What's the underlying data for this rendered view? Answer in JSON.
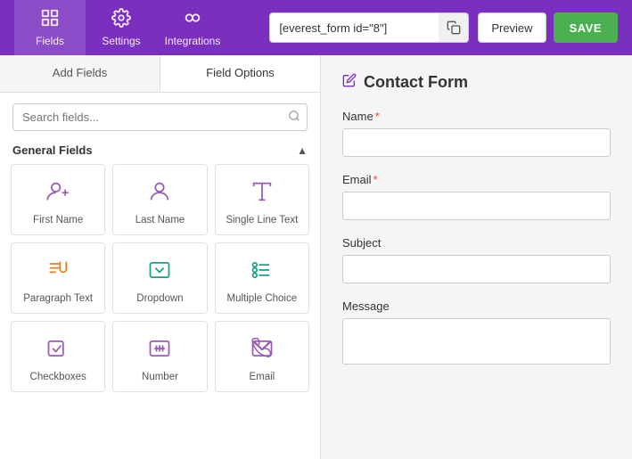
{
  "nav": {
    "items": [
      {
        "id": "fields",
        "label": "Fields",
        "active": true
      },
      {
        "id": "settings",
        "label": "Settings",
        "active": false
      },
      {
        "id": "integrations",
        "label": "Integrations",
        "active": false
      }
    ]
  },
  "toolbar": {
    "shortcode_value": "[everest_form id=\"8\"]",
    "preview_label": "Preview",
    "save_label": "SAVE"
  },
  "left_panel": {
    "tab_add": "Add Fields",
    "tab_options": "Field Options",
    "search_placeholder": "Search fields...",
    "section_label": "General Fields",
    "fields": [
      {
        "id": "first-name",
        "label": "First Name",
        "icon": "person",
        "color": "purple"
      },
      {
        "id": "last-name",
        "label": "Last Name",
        "icon": "person",
        "color": "purple"
      },
      {
        "id": "single-line",
        "label": "Single Line Text",
        "icon": "text",
        "color": "purple"
      },
      {
        "id": "paragraph",
        "label": "Paragraph Text",
        "icon": "paragraph",
        "color": "orange"
      },
      {
        "id": "dropdown",
        "label": "Dropdown",
        "icon": "dropdown",
        "color": "teal"
      },
      {
        "id": "multiple-choice",
        "label": "Multiple Choice",
        "icon": "radio",
        "color": "teal"
      },
      {
        "id": "checkboxes",
        "label": "Checkboxes",
        "icon": "checkbox",
        "color": "purple"
      },
      {
        "id": "number",
        "label": "Number",
        "icon": "number",
        "color": "purple"
      },
      {
        "id": "email",
        "label": "Email",
        "icon": "email",
        "color": "purple"
      }
    ]
  },
  "right_panel": {
    "form_title": "Contact Form",
    "fields": [
      {
        "id": "name",
        "label": "Name",
        "required": true,
        "type": "input"
      },
      {
        "id": "email",
        "label": "Email",
        "required": true,
        "type": "input"
      },
      {
        "id": "subject",
        "label": "Subject",
        "required": false,
        "type": "input"
      },
      {
        "id": "message",
        "label": "Message",
        "required": false,
        "type": "textarea"
      }
    ]
  },
  "colors": {
    "purple": "#7b2fbe",
    "orange": "#e67e22",
    "teal": "#16a085",
    "blue": "#2980b9",
    "green": "#4CAF50",
    "red": "#e74c3c"
  }
}
